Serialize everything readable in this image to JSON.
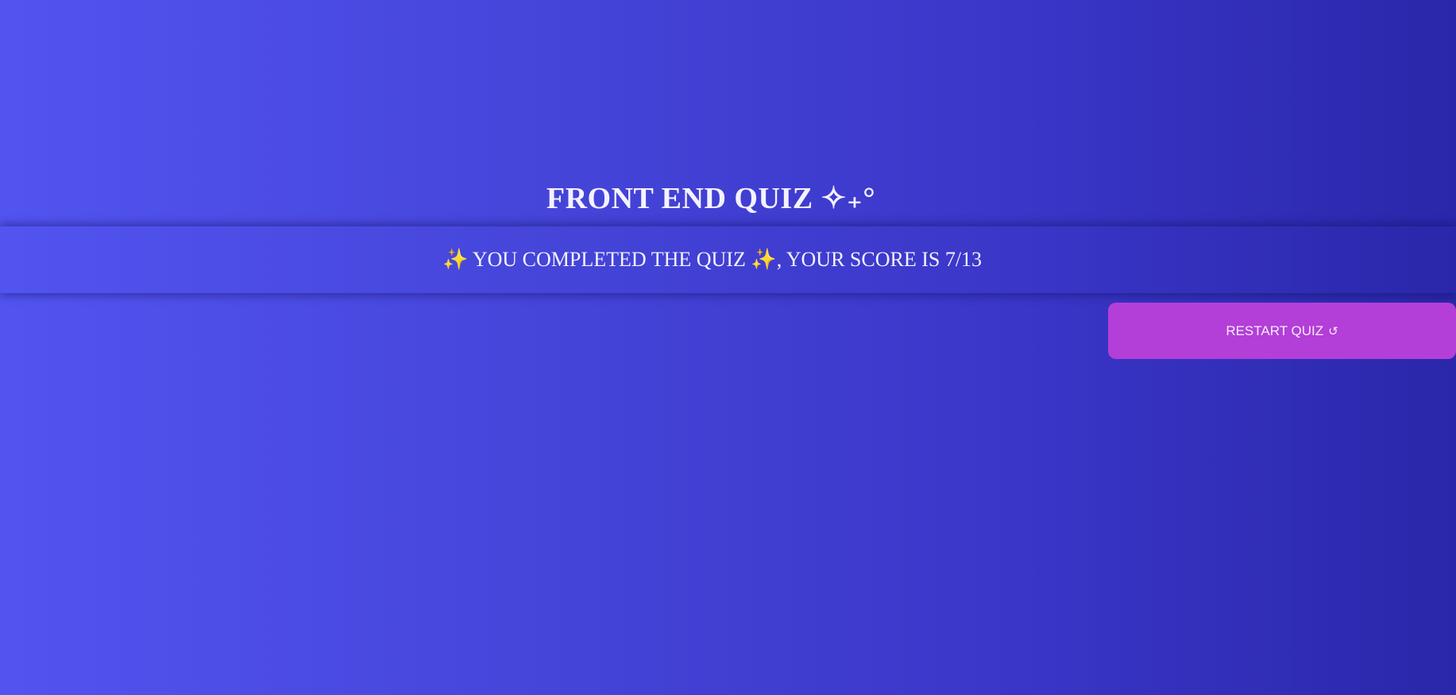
{
  "quiz": {
    "title": "FRONT END QUIZ ✧₊°",
    "result_message": "✨ YOU COMPLETED THE QUIZ ✨, YOUR SCORE IS 7/13"
  },
  "restart": {
    "label": "RESTART QUIZ",
    "icon_glyph": "↺",
    "icon_name": "restart-icon"
  },
  "colors": {
    "background_left": "#5254f0",
    "background_right": "#2a27aa",
    "button": "#b33ed8",
    "text": "#f4f2ff"
  }
}
